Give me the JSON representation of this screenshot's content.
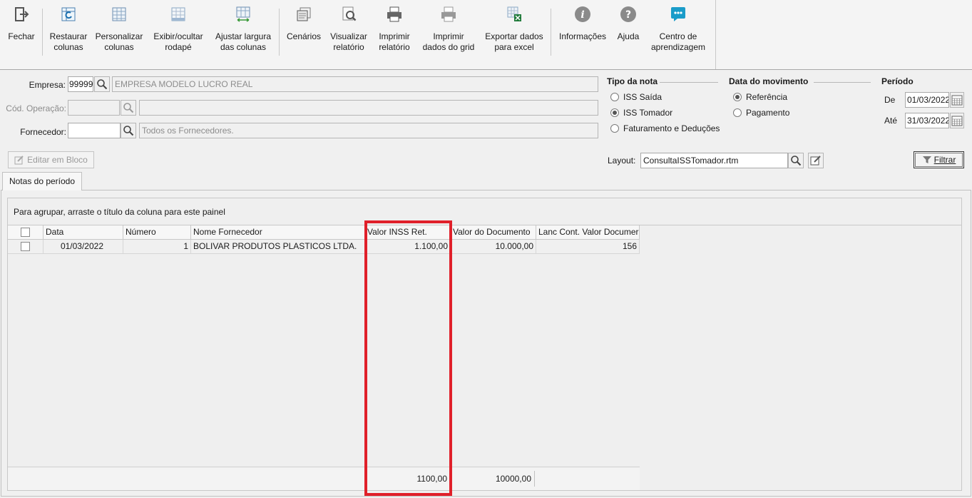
{
  "toolbar": {
    "buttons": [
      {
        "label1": "Fechar",
        "label2": "",
        "icon": "exit-icon"
      },
      {
        "label1": "Restaurar",
        "label2": "colunas",
        "icon": "restore-columns-icon"
      },
      {
        "label1": "Personalizar",
        "label2": "colunas",
        "icon": "customize-columns-icon"
      },
      {
        "label1": "Exibir/ocultar",
        "label2": "rodapé",
        "icon": "footer-icon"
      },
      {
        "label1": "Ajustar largura",
        "label2": "das colunas",
        "icon": "adjust-width-icon"
      },
      {
        "label1": "Cenários",
        "label2": "",
        "icon": "scenarios-icon"
      },
      {
        "label1": "Visualizar",
        "label2": "relatório",
        "icon": "preview-icon"
      },
      {
        "label1": "Imprimir",
        "label2": "relatório",
        "icon": "printer-icon"
      },
      {
        "label1": "Imprimir",
        "label2": "dados do grid",
        "icon": "print-grid-icon"
      },
      {
        "label1": "Exportar dados",
        "label2": "para excel",
        "icon": "excel-icon"
      },
      {
        "label1": "Informações",
        "label2": "",
        "icon": "info-icon"
      },
      {
        "label1": "Ajuda",
        "label2": "",
        "icon": "help-icon"
      },
      {
        "label1": "Centro de",
        "label2": "aprendizagem",
        "icon": "learning-center-icon"
      }
    ]
  },
  "form": {
    "empresa_label": "Empresa:",
    "empresa_code": "99999",
    "empresa_name": "EMPRESA MODELO LUCRO REAL",
    "cod_operacao_label": "Cód. Operação:",
    "cod_operacao_value": "",
    "cod_operacao_desc": "",
    "fornecedor_label": "Fornecedor:",
    "fornecedor_value": "",
    "fornecedor_desc": "Todos os Fornecedores.",
    "editar_bloco": "Editar em Bloco",
    "layout_label": "Layout:",
    "layout_value": "ConsultaISSTomador.rtm",
    "filtrar": "Filtrar"
  },
  "tipo_nota": {
    "title": "Tipo da nota",
    "options": [
      "ISS Saída",
      "ISS Tomador",
      "Faturamento e Deduções"
    ],
    "selected": "ISS Tomador"
  },
  "data_movimento": {
    "title": "Data do movimento",
    "options": [
      "Referência",
      "Pagamento"
    ],
    "selected": "Referência"
  },
  "periodo": {
    "title": "Período",
    "de_label": "De",
    "de_value": "01/03/2022",
    "ate_label": "Até",
    "ate_value": "31/03/2022"
  },
  "tab": {
    "label": "Notas do período"
  },
  "grid": {
    "group_panel_text": "Para agrupar, arraste o título da coluna para este painel",
    "columns": [
      "Data",
      "Número",
      "Nome Fornecedor",
      "Valor INSS Ret.",
      "Valor do Documento",
      "Lanc Cont. Valor Documer"
    ],
    "rows": [
      {
        "data": "01/03/2022",
        "numero": "1",
        "fornecedor": "BOLIVAR PRODUTOS PLASTICOS LTDA.",
        "valor_inss": "1.100,00",
        "valor_doc": "10.000,00",
        "lanc": "156"
      }
    ],
    "footer": {
      "valor_inss_total": "1100,00",
      "valor_doc_total": "10000,00"
    }
  },
  "colors": {
    "highlight": "#e0202a",
    "accent": "#1a9cc9"
  }
}
